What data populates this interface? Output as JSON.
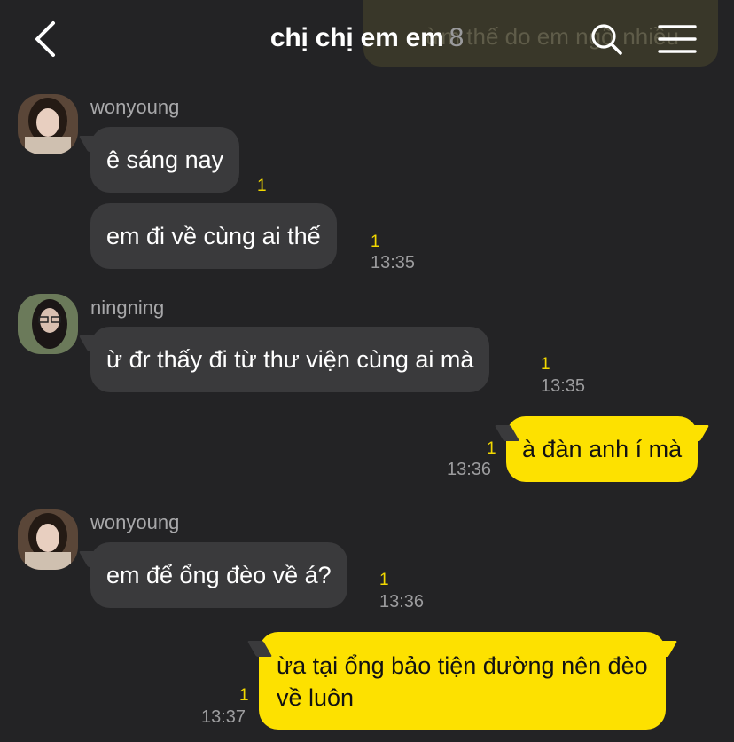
{
  "header": {
    "title": "chị chị em em",
    "member_count": "8",
    "ghost_text": "ừm thế do em ngỡ nhiều"
  },
  "messages": [
    {
      "sender": "wonyoung",
      "text": "ê sáng nay",
      "unread": "1",
      "time": ""
    },
    {
      "sender": "",
      "text": "em đi về cùng ai thế",
      "unread": "1",
      "time": "13:35"
    },
    {
      "sender": "ningning",
      "text": "ừ đr thấy đi từ thư viện cùng ai mà",
      "unread": "1",
      "time": "13:35"
    },
    {
      "sender": "me",
      "text": "à đàn anh í mà",
      "unread": "1",
      "time": "13:36"
    },
    {
      "sender": "wonyoung",
      "text": "em để ổng đèo về á?",
      "unread": "1",
      "time": "13:36"
    },
    {
      "sender": "me",
      "text_line1": "ừa tại ổng bảo tiện đường nên đèo",
      "text_line2": "về luôn",
      "unread": "1",
      "time": "13:37"
    }
  ],
  "colors": {
    "background": "#232325",
    "incoming_bubble": "#3a3a3c",
    "outgoing_bubble": "#fde100",
    "unread": "#f2d800"
  },
  "icons": [
    "back-chevron-icon",
    "search-icon",
    "menu-icon"
  ]
}
